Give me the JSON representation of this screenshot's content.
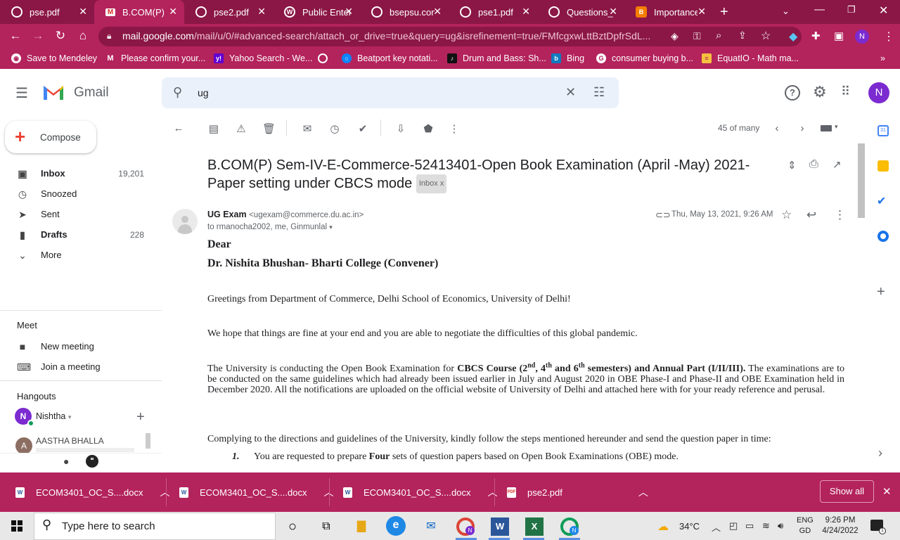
{
  "browser": {
    "tabs": [
      {
        "title": "pse.pdf",
        "icon": "chrome-icon"
      },
      {
        "title": "B.COM(P) S",
        "icon": "gmail-icon"
      },
      {
        "title": "pse2.pdf",
        "icon": "chrome-icon"
      },
      {
        "title": "Public Enter",
        "icon": "wordpress-icon"
      },
      {
        "title": "bsepsu.com",
        "icon": "chrome-icon"
      },
      {
        "title": "pse1.pdf",
        "icon": "chrome-icon"
      },
      {
        "title": "Questions_i",
        "icon": "chrome-icon"
      },
      {
        "title": "Importance",
        "icon": "blogger-icon"
      }
    ],
    "url_domain": "mail.google.com",
    "url_path": "/mail/u/0/#advanced-search/attach_or_drive=true&query=ug&isrefinement=true/FMfcgxwLttBztDpfrSdL...",
    "profile_initial": "N",
    "bookmarks": [
      "Save to Mendeley",
      "Please confirm your...",
      "Yahoo Search - We...",
      "Beatport key notati...",
      "Drum and Bass: Sh...",
      "Bing",
      "consumer buying b...",
      "EquatIO - Math ma..."
    ],
    "bookmarks_overflow": "»"
  },
  "gmail": {
    "logo_text": "Gmail",
    "search_value": "ug",
    "avatar_initial": "N",
    "compose_label": "Compose",
    "nav": [
      {
        "label": "Inbox",
        "count": "19,201",
        "bold": true
      },
      {
        "label": "Snoozed",
        "count": ""
      },
      {
        "label": "Sent",
        "count": ""
      },
      {
        "label": "Drafts",
        "count": "228",
        "bold": true
      },
      {
        "label": "More",
        "count": ""
      }
    ],
    "meet_heading": "Meet",
    "meet_items": [
      "New meeting",
      "Join a meeting"
    ],
    "hangouts_heading": "Hangouts",
    "hangouts_user": "Nishtha",
    "hangouts_contact": "AASTHA BHALLA",
    "pager": "45 of many"
  },
  "email": {
    "subject": "B.COM(P) Sem-IV-E-Commerce-52413401-Open Book Examination (April -May) 2021-Paper setting under CBCS mode",
    "label": "Inbox",
    "sender_name": "UG Exam",
    "sender_email": "<ugexam@commerce.du.ac.in>",
    "recipients": "to rmanocha2002, me, Ginmunlal",
    "date": "Thu, May 13, 2021, 9:26 AM",
    "salutation": "Dear",
    "addressee": "Dr. Nishita Bhushan- Bharti College (Convener)",
    "greeting": "Greetings from Department of Commerce, Delhi School of Economics, University of Delhi!",
    "hope": "We hope that things are fine at your end and you are able to negotiate the difficulties of this global pandemic.",
    "p3_a": "The University is conducting the Open Book Examination for ",
    "p3_b": "CBCS Course (2",
    "p3_sup1": "nd",
    "p3_c": ", 4",
    "p3_sup2": "th",
    "p3_d": " and 6",
    "p3_sup3": "th",
    "p3_e": " semesters) and Annual Part (I/II/III).",
    "p3_f": " The examinations are to be conducted on the same guidelines which had already been issued earlier in July and August 2020 in OBE Phase-I and Phase-II and OBE Examination held in December 2020. All the notifications are uploaded on the official website of University of Delhi and attached here with for your ready reference and perusal.",
    "p4": "Complying to the directions and guidelines of the University, kindly follow the steps mentioned hereunder and send the question paper in time:",
    "list_num": "1.",
    "list_a": "You are requested to prepare ",
    "list_b": "Four",
    "list_c": " sets of question papers based on Open Book Examinations (OBE) mode."
  },
  "downloads": {
    "items": [
      {
        "name": "ECOM3401_OC_S....docx",
        "type": "word"
      },
      {
        "name": "ECOM3401_OC_S....docx",
        "type": "word"
      },
      {
        "name": "ECOM3401_OC_S....docx",
        "type": "word"
      },
      {
        "name": "pse2.pdf",
        "type": "pdf"
      }
    ],
    "show_all": "Show all"
  },
  "taskbar": {
    "search_placeholder": "Type here to search",
    "temperature": "34°C",
    "lang_top": "ENG",
    "lang_bottom": "GD",
    "time": "9:26 PM",
    "date": "4/24/2022"
  }
}
